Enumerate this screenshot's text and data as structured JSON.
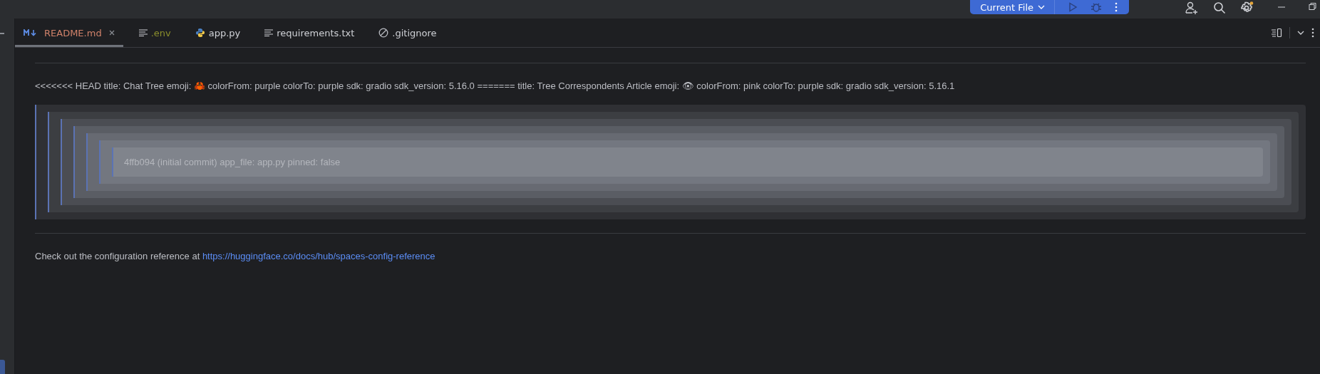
{
  "toolbar": {
    "run_config": "Current File"
  },
  "tabs": [
    {
      "label": "README.md",
      "kind": "markdown",
      "color": "#d0826a",
      "selected": true
    },
    {
      "label": ".env",
      "kind": "text",
      "color": "#8b8e2c",
      "selected": false
    },
    {
      "label": "app.py",
      "kind": "python",
      "color": "#cfd1d6",
      "selected": false
    },
    {
      "label": "requirements.txt",
      "kind": "text",
      "color": "#cfd1d6",
      "selected": false
    },
    {
      "label": ".gitignore",
      "kind": "ignore",
      "color": "#cfd1d6",
      "selected": false
    }
  ],
  "document": {
    "heading_text": "<<<<<<< HEAD title: Chat Tree emoji: 🦀 colorFrom: purple colorTo: purple sdk: gradio sdk_version: 5.16.0 ======= title: Tree Correspondents Article emoji: 👁 colorFrom: pink colorTo: purple sdk: gradio sdk_version: 5.16.1",
    "blockquote": {
      "children": [
        {
          "children": [
            {
              "children": [
                {
                  "children": [
                    {
                      "children": [
                        {
                          "children": [
                            {
                              "text": "4ffb094 (initial commit) app_file: app.py pinned: false"
                            }
                          ]
                        }
                      ]
                    }
                  ]
                }
              ]
            }
          ]
        }
      ]
    },
    "footer_text": "Check out the configuration reference at ",
    "footer_link": "https://huggingface.co/docs/hub/spaces-config-reference"
  }
}
